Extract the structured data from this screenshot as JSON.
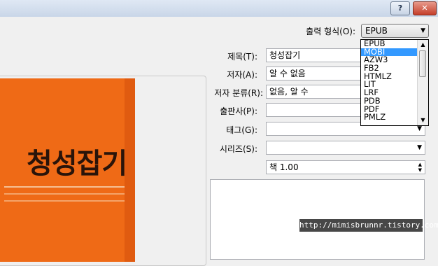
{
  "window": {
    "help_label": "?",
    "close_label": "✕"
  },
  "output_format": {
    "label": "출력 형식(O):",
    "value": "EPUB",
    "options": [
      "EPUB",
      "MOBI",
      "AZW3",
      "FB2",
      "HTMLZ",
      "LIT",
      "LRF",
      "PDB",
      "PDF",
      "PMLZ"
    ],
    "selected_index": 1
  },
  "cover": {
    "title_text": "청성잡기",
    "background_color": "#ef6a16"
  },
  "metadata": {
    "title_label": "제목(T):",
    "title_value": "청성잡기",
    "author_label": "저자(A):",
    "author_value": "알 수 없음",
    "author_sort_label": "저자 분류(R):",
    "author_sort_value": "없음, 알 수",
    "publisher_label": "출판사(P):",
    "publisher_value": "",
    "tags_label": "태그(G):",
    "tags_value": "",
    "series_label": "시리즈(S):",
    "series_value": "",
    "series_index_value": "책 1.00"
  },
  "watermark": "http://mimisbrunnr.tistory.com"
}
